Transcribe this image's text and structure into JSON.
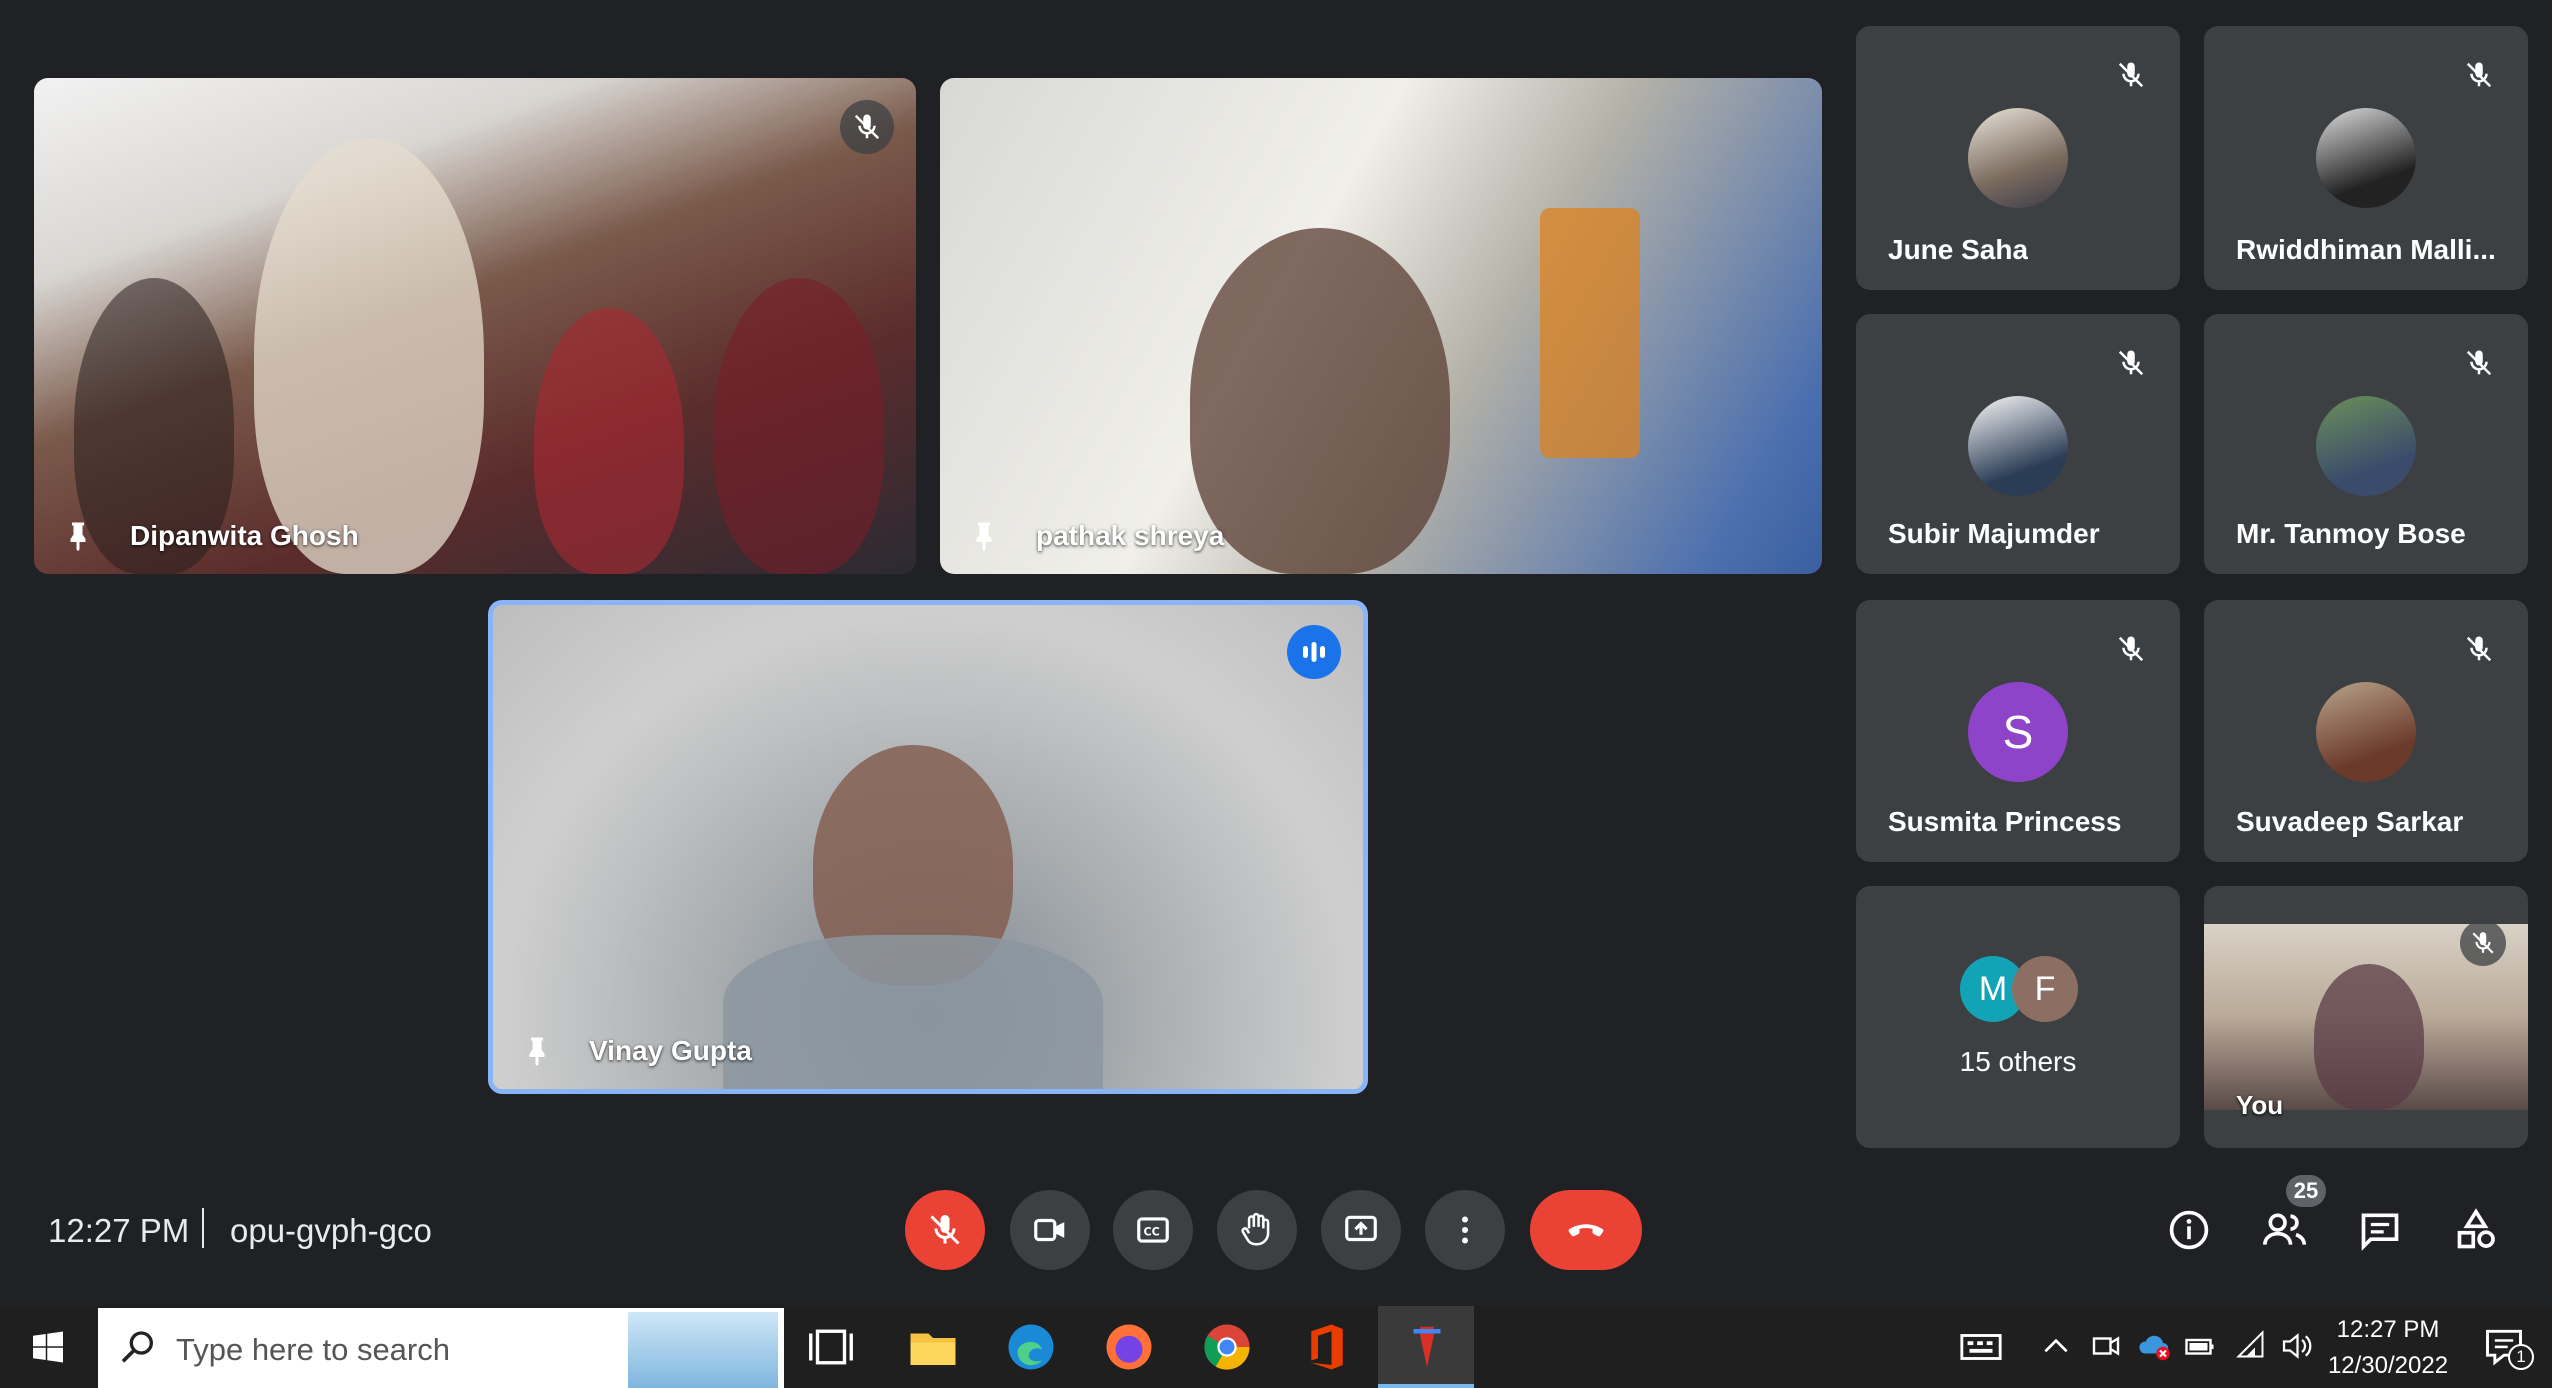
{
  "tiles": {
    "tile1": {
      "name": "Dipanwita Ghosh"
    },
    "tile2": {
      "name": "pathak shreya"
    },
    "tile3": {
      "name": "Vinay Gupta"
    }
  },
  "participants": [
    {
      "name": "June Saha"
    },
    {
      "name": "Rwiddhiman Malli..."
    },
    {
      "name": "Subir Majumder"
    },
    {
      "name": "Mr. Tanmoy Bose"
    },
    {
      "name": "Susmita Princess",
      "initial": "S"
    },
    {
      "name": "Suvadeep Sarkar"
    }
  ],
  "others": {
    "label": "15 others",
    "initials": [
      "M",
      "F"
    ]
  },
  "self_tile": {
    "label": "You"
  },
  "meeting": {
    "time": "12:27 PM",
    "code": "opu-gvph-gco"
  },
  "people_count": "25",
  "taskbar": {
    "search_placeholder": "Type here to search",
    "clock_time": "12:27 PM",
    "clock_date": "12/30/2022",
    "notification_count": "1"
  },
  "colors": {
    "accent_blue": "#8ab4f8",
    "mute_red": "#ea4335",
    "susmita_avatar": "#8e44c8",
    "m_avatar": "#12a4b6",
    "f_avatar": "#8d6e63"
  }
}
